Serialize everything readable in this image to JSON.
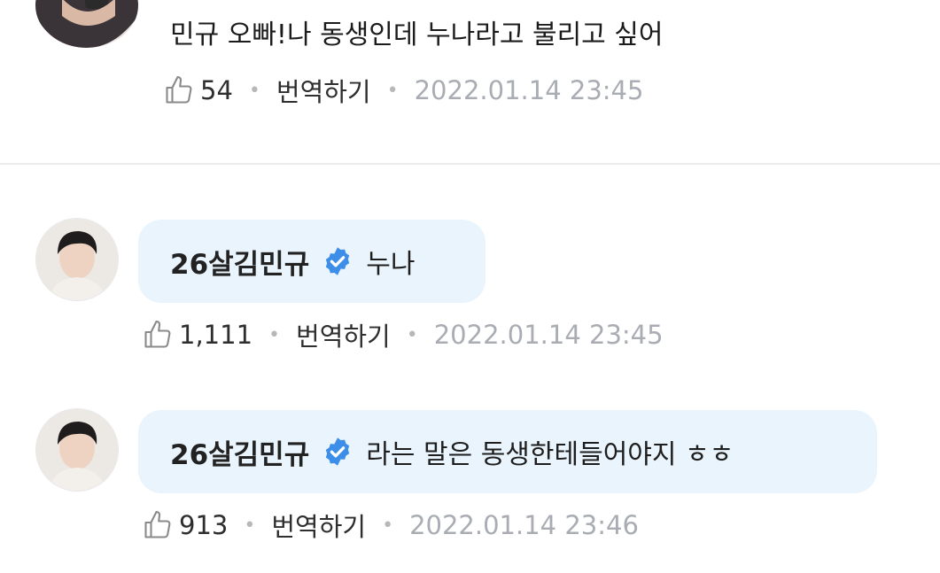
{
  "comments": [
    {
      "text": "민규 오빠!나 동생인데 누나라고 불리고 싶어",
      "likes": "54",
      "translate": "번역하기",
      "time": "2022.01.14 23:45"
    },
    {
      "author": "26살김민규",
      "text": "누나",
      "likes": "1,111",
      "translate": "번역하기",
      "time": "2022.01.14 23:45"
    },
    {
      "author": "26살김민규",
      "text": "라는 말은 동생한테들어야지 ㅎㅎ",
      "likes": "913",
      "translate": "번역하기",
      "time": "2022.01.14 23:46"
    }
  ],
  "colors": {
    "bubble": "#eaf4fc",
    "verified": "#3d8ee8",
    "timestamp": "#a9adb3",
    "divider": "#ececec"
  },
  "icons": {
    "like": "thumbs-up-icon",
    "verified": "verified-badge-icon"
  }
}
